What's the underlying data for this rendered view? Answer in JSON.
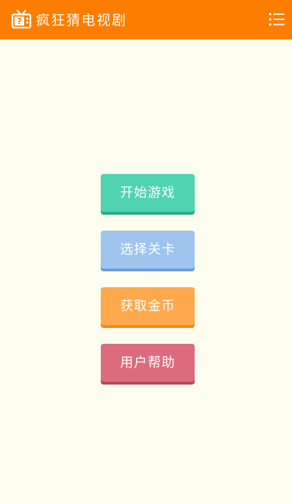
{
  "app": {
    "title": "疯狂猜电视剧",
    "accent_color": "#fd7d00",
    "background_color": "#fcfdef",
    "logo_icon": "tv-question-icon",
    "menu_icon": "list-menu-icon"
  },
  "menu": {
    "start_game": "开始游戏",
    "select_level": "选择关卡",
    "get_coins": "获取金币",
    "user_help": "用户帮助"
  },
  "colors": {
    "start_game": "#4fd3b0",
    "select_level": "#9fc4ee",
    "get_coins": "#ffa94d",
    "user_help": "#dc6b7e"
  }
}
